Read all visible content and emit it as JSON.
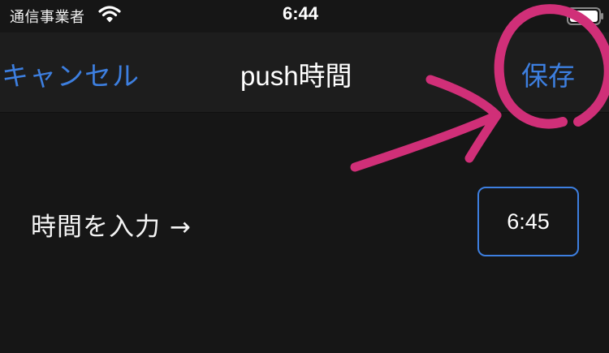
{
  "status_bar": {
    "carrier": "通信事業者",
    "time": "6:44",
    "wifi_icon": "wifi-icon",
    "battery_icon": "battery-icon"
  },
  "nav": {
    "cancel_label": "キャンセル",
    "title": "push時間",
    "save_label": "保存"
  },
  "content": {
    "row_label": "時間を入力 →",
    "time_value": "6:45"
  },
  "colors": {
    "background": "#161616",
    "nav_background": "#1d1d1d",
    "accent": "#3d7fe0",
    "annotation": "#d02f78"
  }
}
